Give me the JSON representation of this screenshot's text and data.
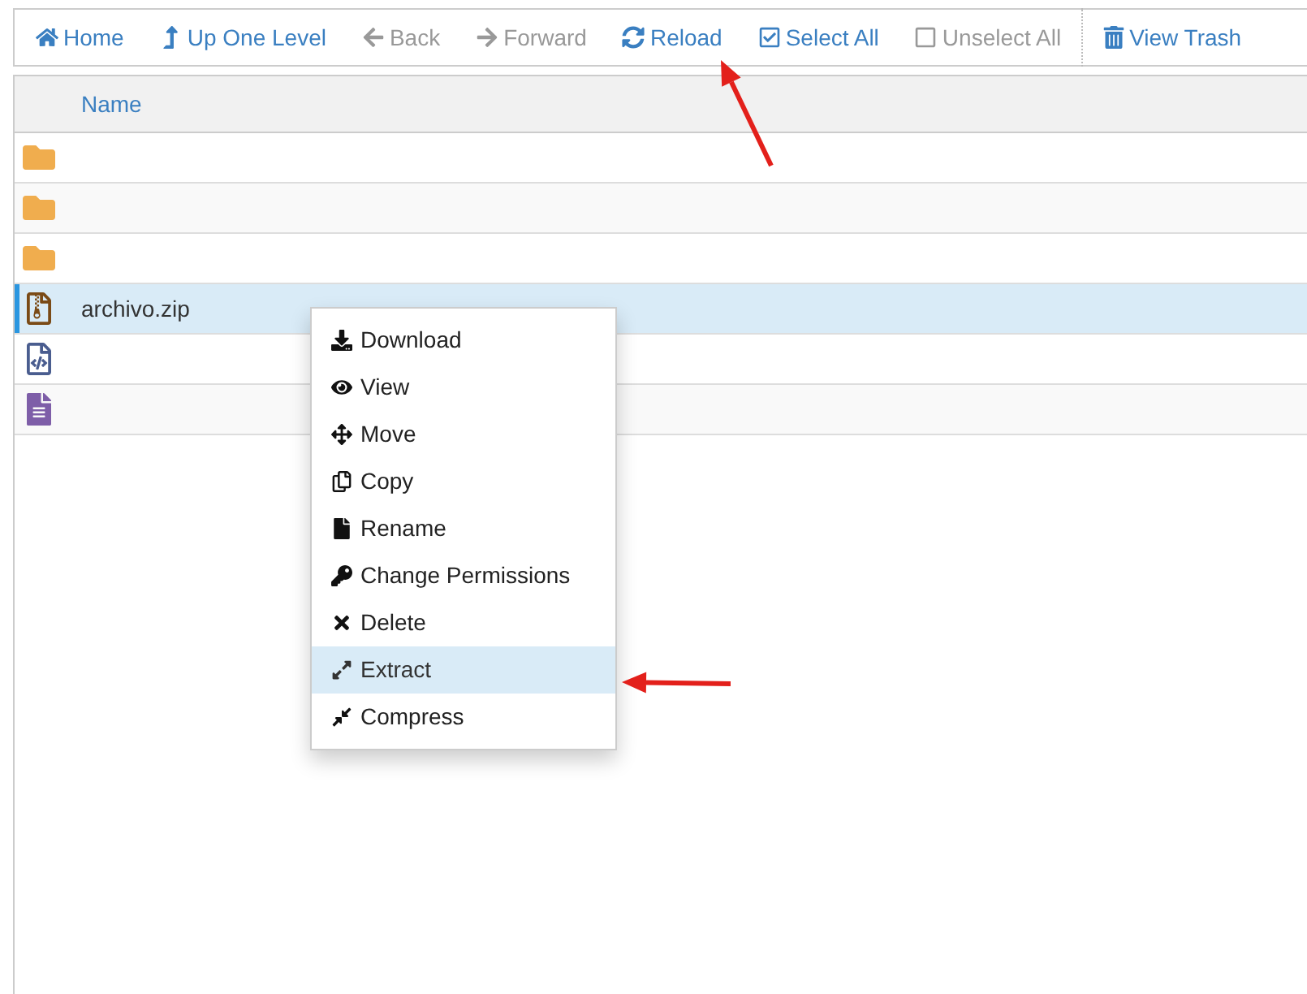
{
  "toolbar": {
    "items": [
      {
        "kind": "home",
        "label": "Home",
        "disabled": false,
        "separator_before": false
      },
      {
        "kind": "up",
        "label": "Up One Level",
        "disabled": false,
        "separator_before": false
      },
      {
        "kind": "back",
        "label": "Back",
        "disabled": true,
        "separator_before": false
      },
      {
        "kind": "forward",
        "label": "Forward",
        "disabled": true,
        "separator_before": false
      },
      {
        "kind": "reload",
        "label": "Reload",
        "disabled": false,
        "separator_before": false
      },
      {
        "kind": "select_all",
        "label": "Select All",
        "disabled": false,
        "separator_before": false
      },
      {
        "kind": "unselect_all",
        "label": "Unselect All",
        "disabled": true,
        "separator_before": false
      },
      {
        "kind": "trash",
        "label": "View Trash",
        "disabled": false,
        "separator_before": true
      }
    ]
  },
  "table": {
    "columns": [
      {
        "label": "Name"
      }
    ],
    "rows": [
      {
        "kind": "folder",
        "selected": false
      },
      {
        "kind": "folder",
        "selected": false
      },
      {
        "kind": "folder",
        "selected": false
      },
      {
        "kind": "zip",
        "name": "archivo.zip",
        "selected": true
      },
      {
        "kind": "code",
        "selected": false
      },
      {
        "kind": "text",
        "selected": false
      }
    ]
  },
  "context_menu": {
    "items": [
      {
        "kind": "download",
        "label": "Download",
        "selected": false
      },
      {
        "kind": "view",
        "label": "View",
        "selected": false
      },
      {
        "kind": "move",
        "label": "Move",
        "selected": false
      },
      {
        "kind": "copy",
        "label": "Copy",
        "selected": false
      },
      {
        "kind": "rename",
        "label": "Rename",
        "selected": false
      },
      {
        "kind": "permissions",
        "label": "Change Permissions",
        "selected": false
      },
      {
        "kind": "delete",
        "label": "Delete",
        "selected": false
      },
      {
        "kind": "extract",
        "label": "Extract",
        "selected": true
      },
      {
        "kind": "compress",
        "label": "Compress",
        "selected": false
      }
    ]
  }
}
